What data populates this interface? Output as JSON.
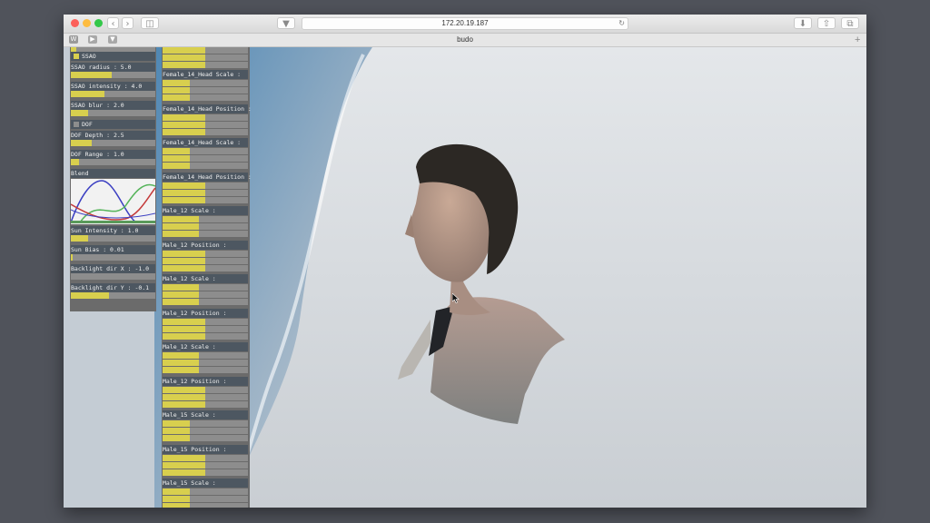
{
  "browser": {
    "url": "172.20.19.187",
    "tab_title": "budo",
    "favorites": [
      "W",
      "▶",
      "▼"
    ],
    "new_tab": "+",
    "icons": {
      "back": "chevron-left-icon",
      "forward": "chevron-right-icon",
      "sidebar": "sidebar-icon",
      "pocket": "pocket-icon",
      "reload": "reload-icon",
      "download": "download-icon",
      "share": "share-icon",
      "tabs": "tabs-icon"
    }
  },
  "left_panel": {
    "ssao_toggle": {
      "label": "SSAO",
      "checked": true
    },
    "sliders": [
      {
        "label": "SSAO radius : 5.0",
        "fill": 0.48
      },
      {
        "label": "SSAO intensity : 4.0",
        "fill": 0.4
      },
      {
        "label": "SSAO blur : 2.0",
        "fill": 0.2
      },
      {
        "label": "DOF Depth : 2.5",
        "fill": 0.25
      },
      {
        "label": "DOF Range : 1.0",
        "fill": 0.1
      }
    ],
    "dof_toggle": {
      "label": "DOF",
      "checked": false
    },
    "blend_label": "Blend",
    "lower_sliders": [
      {
        "label": "Sun Intensity : 1.0",
        "fill": 0.2
      },
      {
        "label": "Sun Bias : 0.01",
        "fill": 0.02
      },
      {
        "label": "Backlight dir X : -1.0",
        "fill": 0.0
      },
      {
        "label": "Backlight dir Y : -0.1",
        "fill": 0.45
      }
    ]
  },
  "right_panel": {
    "groups": [
      {
        "label": "Female_14_Head Scale :",
        "fills": [
          0.32,
          0.32,
          0.32
        ]
      },
      {
        "label": "Female_14_Head Position :",
        "fills": [
          0.5,
          0.5,
          0.5
        ]
      },
      {
        "label": "Female_14_Head Scale :",
        "fills": [
          0.32,
          0.32,
          0.32
        ]
      },
      {
        "label": "Female_14_Head Position :",
        "fills": [
          0.5,
          0.5,
          0.5
        ]
      },
      {
        "label": "Male_12 Scale :",
        "fills": [
          0.43,
          0.43,
          0.43
        ]
      },
      {
        "label": "Male_12 Position :",
        "fills": [
          0.5,
          0.5,
          0.5
        ]
      },
      {
        "label": "Male_12 Scale :",
        "fills": [
          0.43,
          0.43,
          0.43
        ]
      },
      {
        "label": "Male_12 Position :",
        "fills": [
          0.5,
          0.5,
          0.5
        ]
      },
      {
        "label": "Male_12 Scale :",
        "fills": [
          0.43,
          0.43,
          0.43
        ]
      },
      {
        "label": "Male_12 Position :",
        "fills": [
          0.5,
          0.5,
          0.5
        ]
      },
      {
        "label": "Male_15 Scale :",
        "fills": [
          0.32,
          0.32,
          0.32
        ]
      },
      {
        "label": "Male_15 Position :",
        "fills": [
          0.5,
          0.5,
          0.5
        ]
      },
      {
        "label": "Male_15 Scale :",
        "fills": [
          0.32,
          0.32,
          0.32
        ]
      }
    ]
  },
  "colors": {
    "slider_fill": "#d8cf4e",
    "panel": "#6b6b6b",
    "label_bg": "#4d5761",
    "track": "#8d8d8d"
  }
}
